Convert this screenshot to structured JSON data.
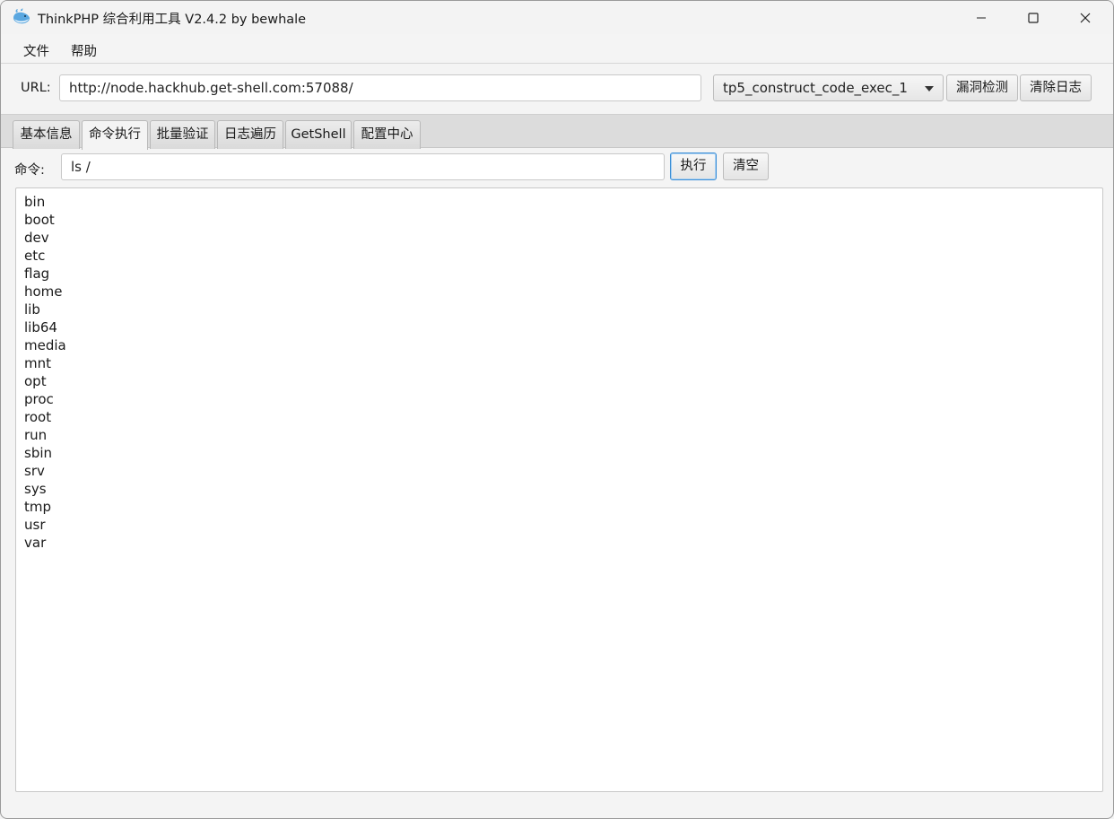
{
  "window": {
    "title": "ThinkPHP 综合利用工具 V2.4.2 by bewhale"
  },
  "menu": {
    "items": [
      {
        "label": "文件"
      },
      {
        "label": "帮助"
      }
    ]
  },
  "target": {
    "url_label": "URL:",
    "url_value": "http://node.hackhub.get-shell.com:57088/",
    "exploit_selected": "tp5_construct_code_exec_1",
    "detect_button": "漏洞检测",
    "clear_log_button": "清除日志"
  },
  "tabs": [
    {
      "label": "基本信息",
      "active": false
    },
    {
      "label": "命令执行",
      "active": true
    },
    {
      "label": "批量验证",
      "active": false
    },
    {
      "label": "日志遍历",
      "active": false
    },
    {
      "label": "GetShell",
      "active": false
    },
    {
      "label": "配置中心",
      "active": false
    }
  ],
  "command": {
    "label": "命令:",
    "value": "ls /",
    "exec_button": "执行",
    "clear_button": "清空"
  },
  "output": {
    "lines": [
      "bin",
      "boot",
      "dev",
      "etc",
      "flag",
      "home",
      "lib",
      "lib64",
      "media",
      "mnt",
      "opt",
      "proc",
      "root",
      "run",
      "sbin",
      "srv",
      "sys",
      "tmp",
      "usr",
      "var"
    ]
  },
  "colors": {
    "focus_border": "#3d8fd6",
    "window_bg": "#f4f4f4",
    "tab_strip_bg": "#dcdcdc"
  }
}
